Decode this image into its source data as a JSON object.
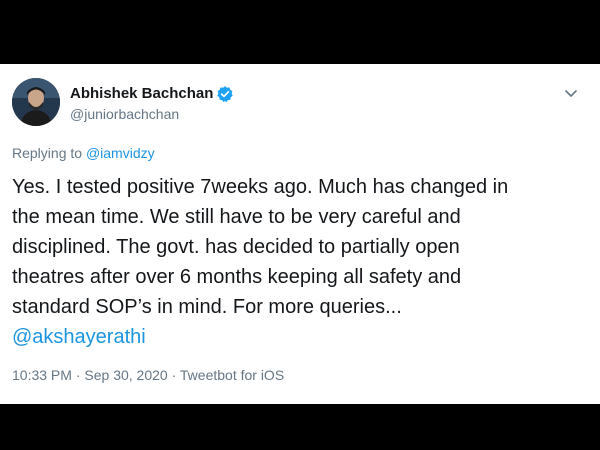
{
  "user": {
    "display_name": "Abhishek Bachchan",
    "handle": "@juniorbachchan",
    "verified": true,
    "avatar_icon": "profile-photo-icon"
  },
  "reply": {
    "prefix": "Replying to",
    "to_handle": "@iamvidzy"
  },
  "tweet": {
    "lines": [
      "Yes. I tested positive 7weeks ago. Much has changed in",
      "the mean time. We still have to be very careful and",
      "disciplined. The govt. has decided to partially open",
      "theatres after over 6 months keeping all safety and",
      "standard SOP’s in mind. For more queries..."
    ],
    "mention": "@akshayerathi"
  },
  "meta": {
    "time": "10:33 PM",
    "separator_1": " · ",
    "date": "Sep 30, 2020",
    "separator_2": " · ",
    "source": "Tweetbot for iOS"
  },
  "colors": {
    "link": "#1b95e0",
    "text": "#14171a",
    "secondary": "#657786",
    "verified": "#1da1f2",
    "letterbox": "#000000"
  },
  "icons": {
    "verified": "verified-badge-icon",
    "menu": "chevron-down-icon"
  }
}
